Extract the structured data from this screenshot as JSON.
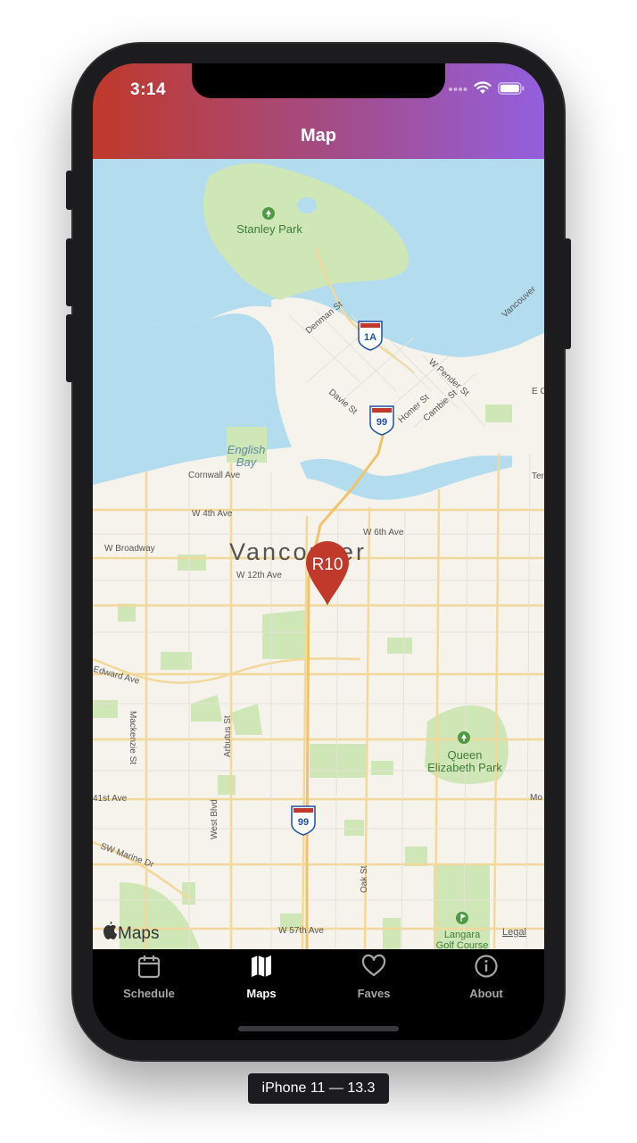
{
  "status_bar": {
    "time": "3:14"
  },
  "header": {
    "title": "Map"
  },
  "map": {
    "city_label": "Vancouver",
    "marker_label": "R10",
    "parks": [
      "Stanley Park",
      "Queen Elizabeth Park",
      "Langara Golf Course"
    ],
    "water": [
      "English Bay"
    ],
    "streets": {
      "denman": "Denman St",
      "davie": "Davie St",
      "w_pender": "W Pender St",
      "homer": "Homer St",
      "cambie": "Cambie St",
      "cornwall": "Cornwall Ave",
      "w4th": "W 4th Ave",
      "w6th": "W 6th Ave",
      "broadway": "W Broadway",
      "w12th": "W 12th Ave",
      "edward": "Edward Ave",
      "mackenzie": "Mackenzie St",
      "arbutus": "Arbutus St",
      "west_blvd": "West Blvd",
      "w41st": "41st Ave",
      "sw_marine": "SW Marine Dr",
      "oak": "Oak St",
      "w57th": "W 57th Ave",
      "vancouver_edge": "Vancouver",
      "e_edge": "E C",
      "ter_edge": "Ter",
      "mo_edge": "Mo"
    },
    "highway_shields": [
      "1A",
      "99",
      "99"
    ],
    "attribution": "Maps",
    "legal": "Legal"
  },
  "tabs": [
    {
      "label": "Schedule",
      "icon": "calendar-icon",
      "active": false
    },
    {
      "label": "Maps",
      "icon": "map-icon",
      "active": true
    },
    {
      "label": "Faves",
      "icon": "heart-icon",
      "active": false
    },
    {
      "label": "About",
      "icon": "info-icon",
      "active": false
    }
  ],
  "device_label": "iPhone 11 — 13.3",
  "colors": {
    "header_gradient_start": "#c0392b",
    "header_gradient_end": "#935fde",
    "marker": "#c0392b",
    "water": "#b3dcef",
    "park": "#cfe6b7",
    "land": "#f6f3ed"
  }
}
